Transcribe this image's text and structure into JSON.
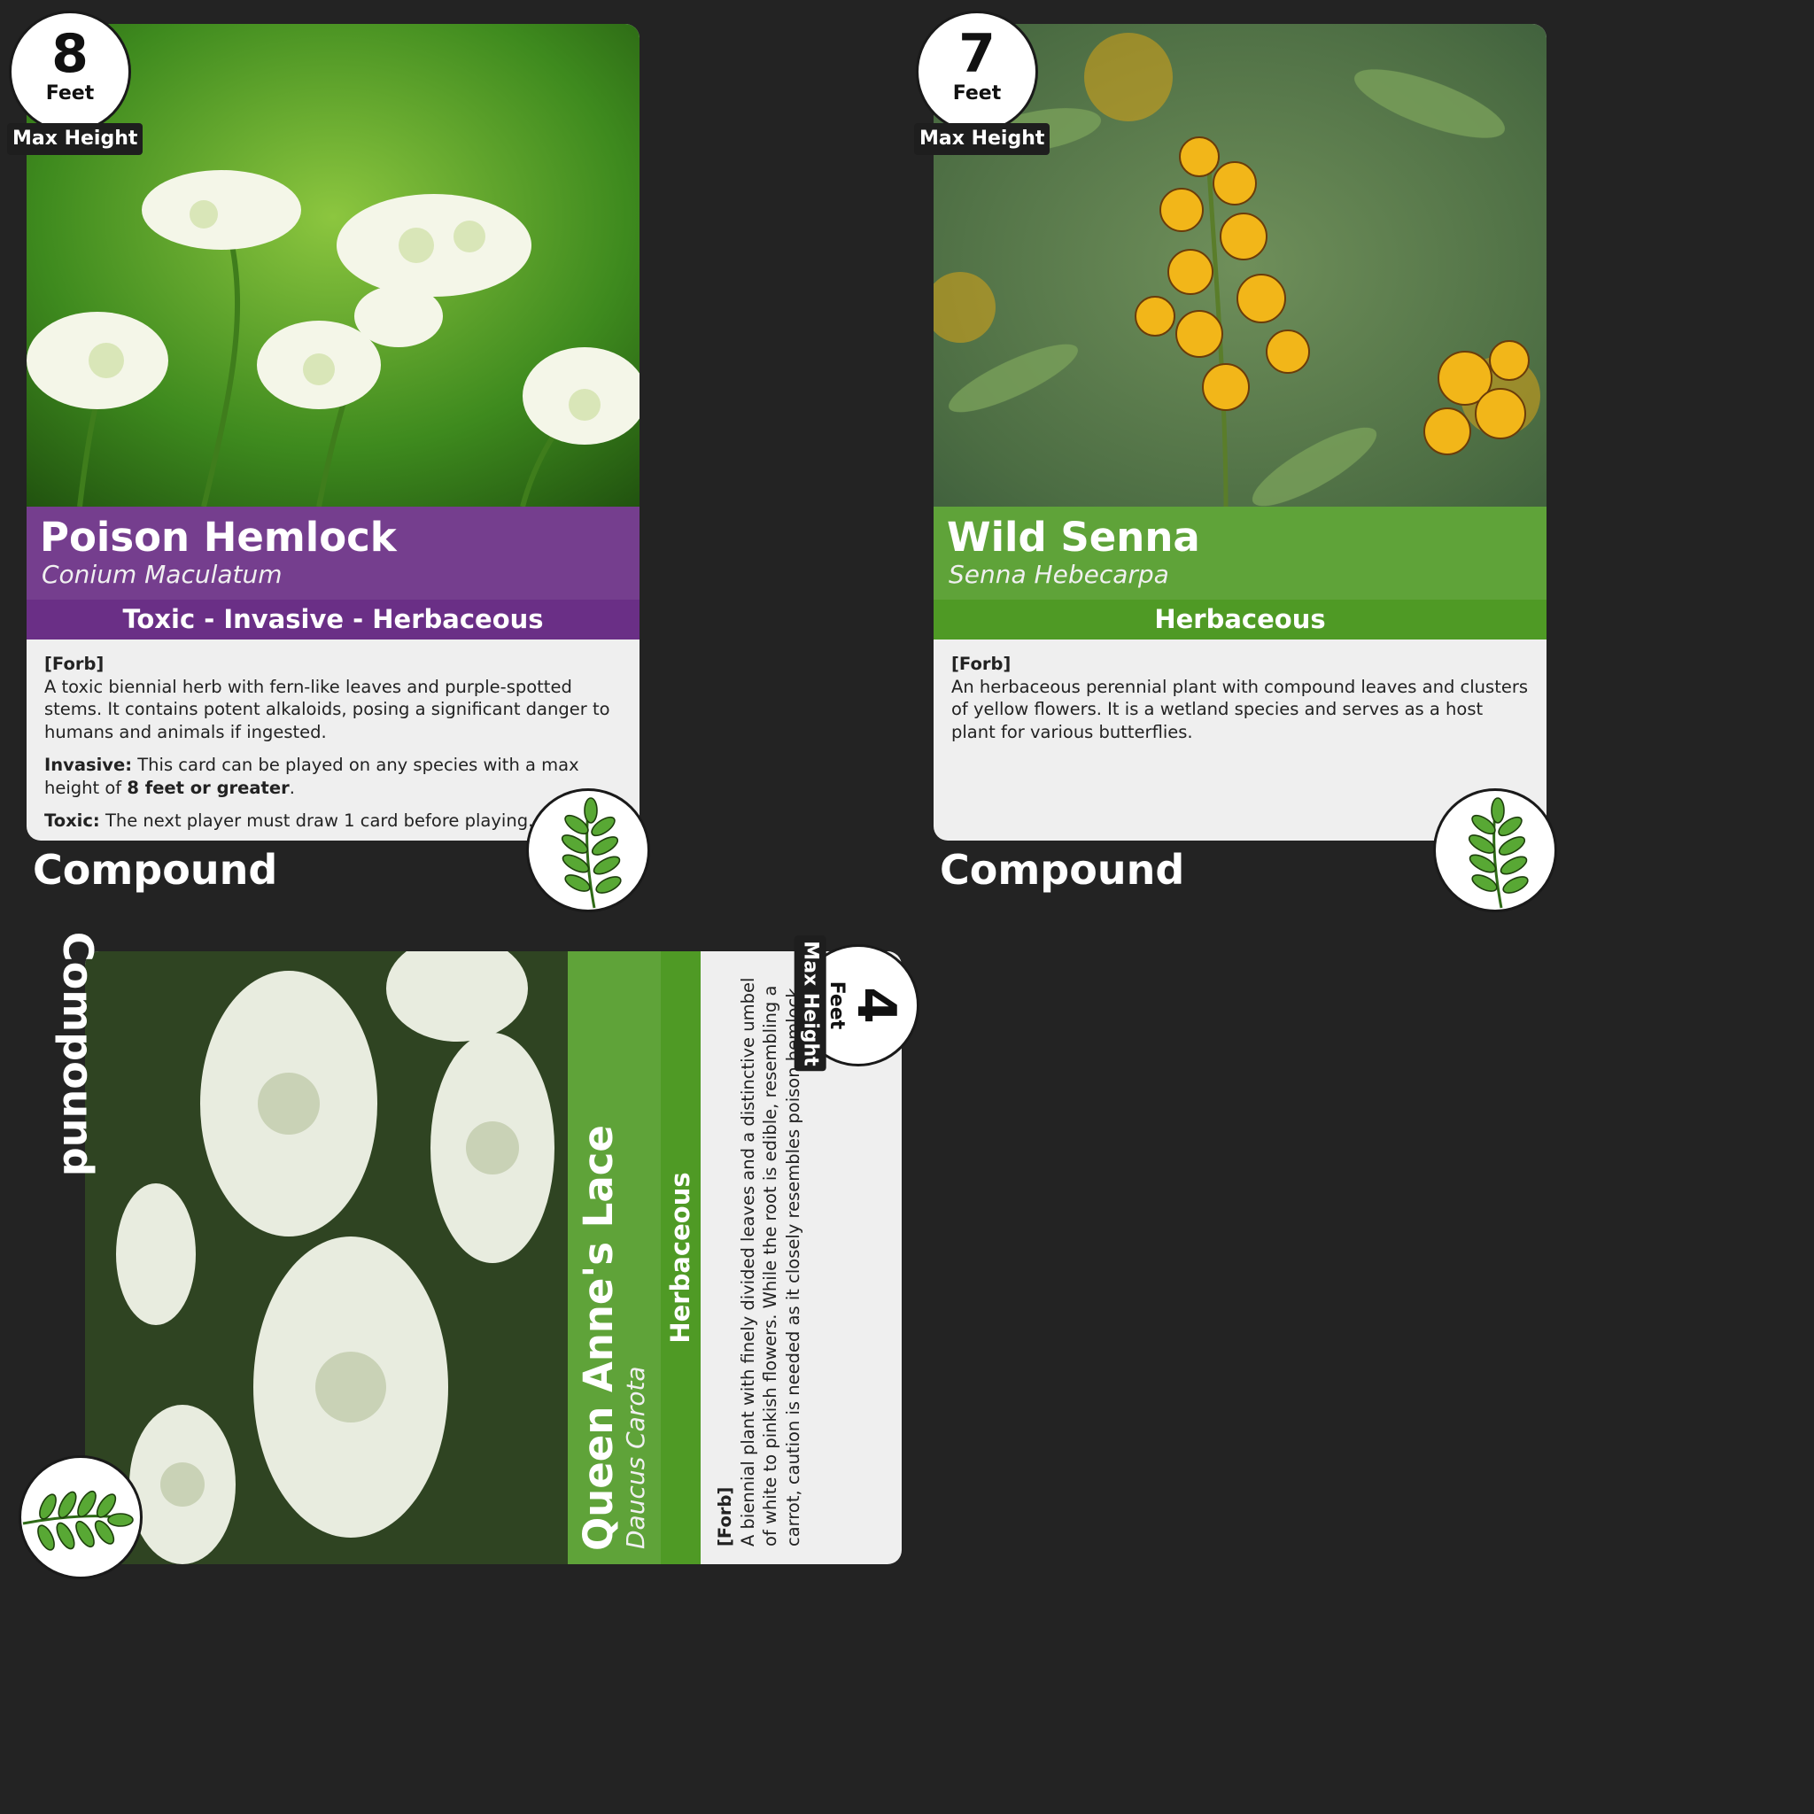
{
  "cards": [
    {
      "height_value": "8",
      "height_unit": "Feet",
      "max_height_label": "Max Height",
      "name": "Poison Hemlock",
      "scientific_name": "Conium Maculatum",
      "traits": "Toxic - Invasive - Herbaceous",
      "band_color": "#6a2f86",
      "type_tag": "[Forb]",
      "description": "A toxic biennial herb with fern-like leaves and purple-spotted stems. It contains potent alkaloids, posing a significant danger to humans and animals if ingested.",
      "rules": [
        {
          "label": "Invasive:",
          "text_before": "This card can be played on any species with a max height of ",
          "bold": "8 feet or greater",
          "text_after": "."
        },
        {
          "label": "Toxic:",
          "text_before": "The next player must draw 1 card before playing.",
          "bold": "",
          "text_after": ""
        }
      ],
      "leaf_type": "Compound",
      "leaf_icon": "compound-leaf-icon"
    },
    {
      "height_value": "7",
      "height_unit": "Feet",
      "max_height_label": "Max Height",
      "name": "Wild Senna",
      "scientific_name": "Senna Hebecarpa",
      "traits": "Herbaceous",
      "band_color": "#4f9a25",
      "type_tag": "[Forb]",
      "description": "An herbaceous perennial plant with compound leaves and clusters of yellow flowers. It is a wetland species and serves as a host plant for various butterflies.",
      "leaf_type": "Compound",
      "leaf_icon": "compound-leaf-icon"
    },
    {
      "height_value": "4",
      "height_unit": "Feet",
      "max_height_label": "Max Height",
      "name": "Queen Anne's Lace",
      "scientific_name": "Daucus Carota",
      "traits": "Herbaceous",
      "band_color": "#4f9a25",
      "type_tag": "[Forb]",
      "description": "A biennial plant with finely divided leaves and a distinctive umbel of white to pinkish flowers. While the root is edible, resembling a carrot, caution is needed as it closely resembles poison hemlock.",
      "leaf_type": "Compound",
      "leaf_icon": "compound-leaf-icon"
    }
  ]
}
